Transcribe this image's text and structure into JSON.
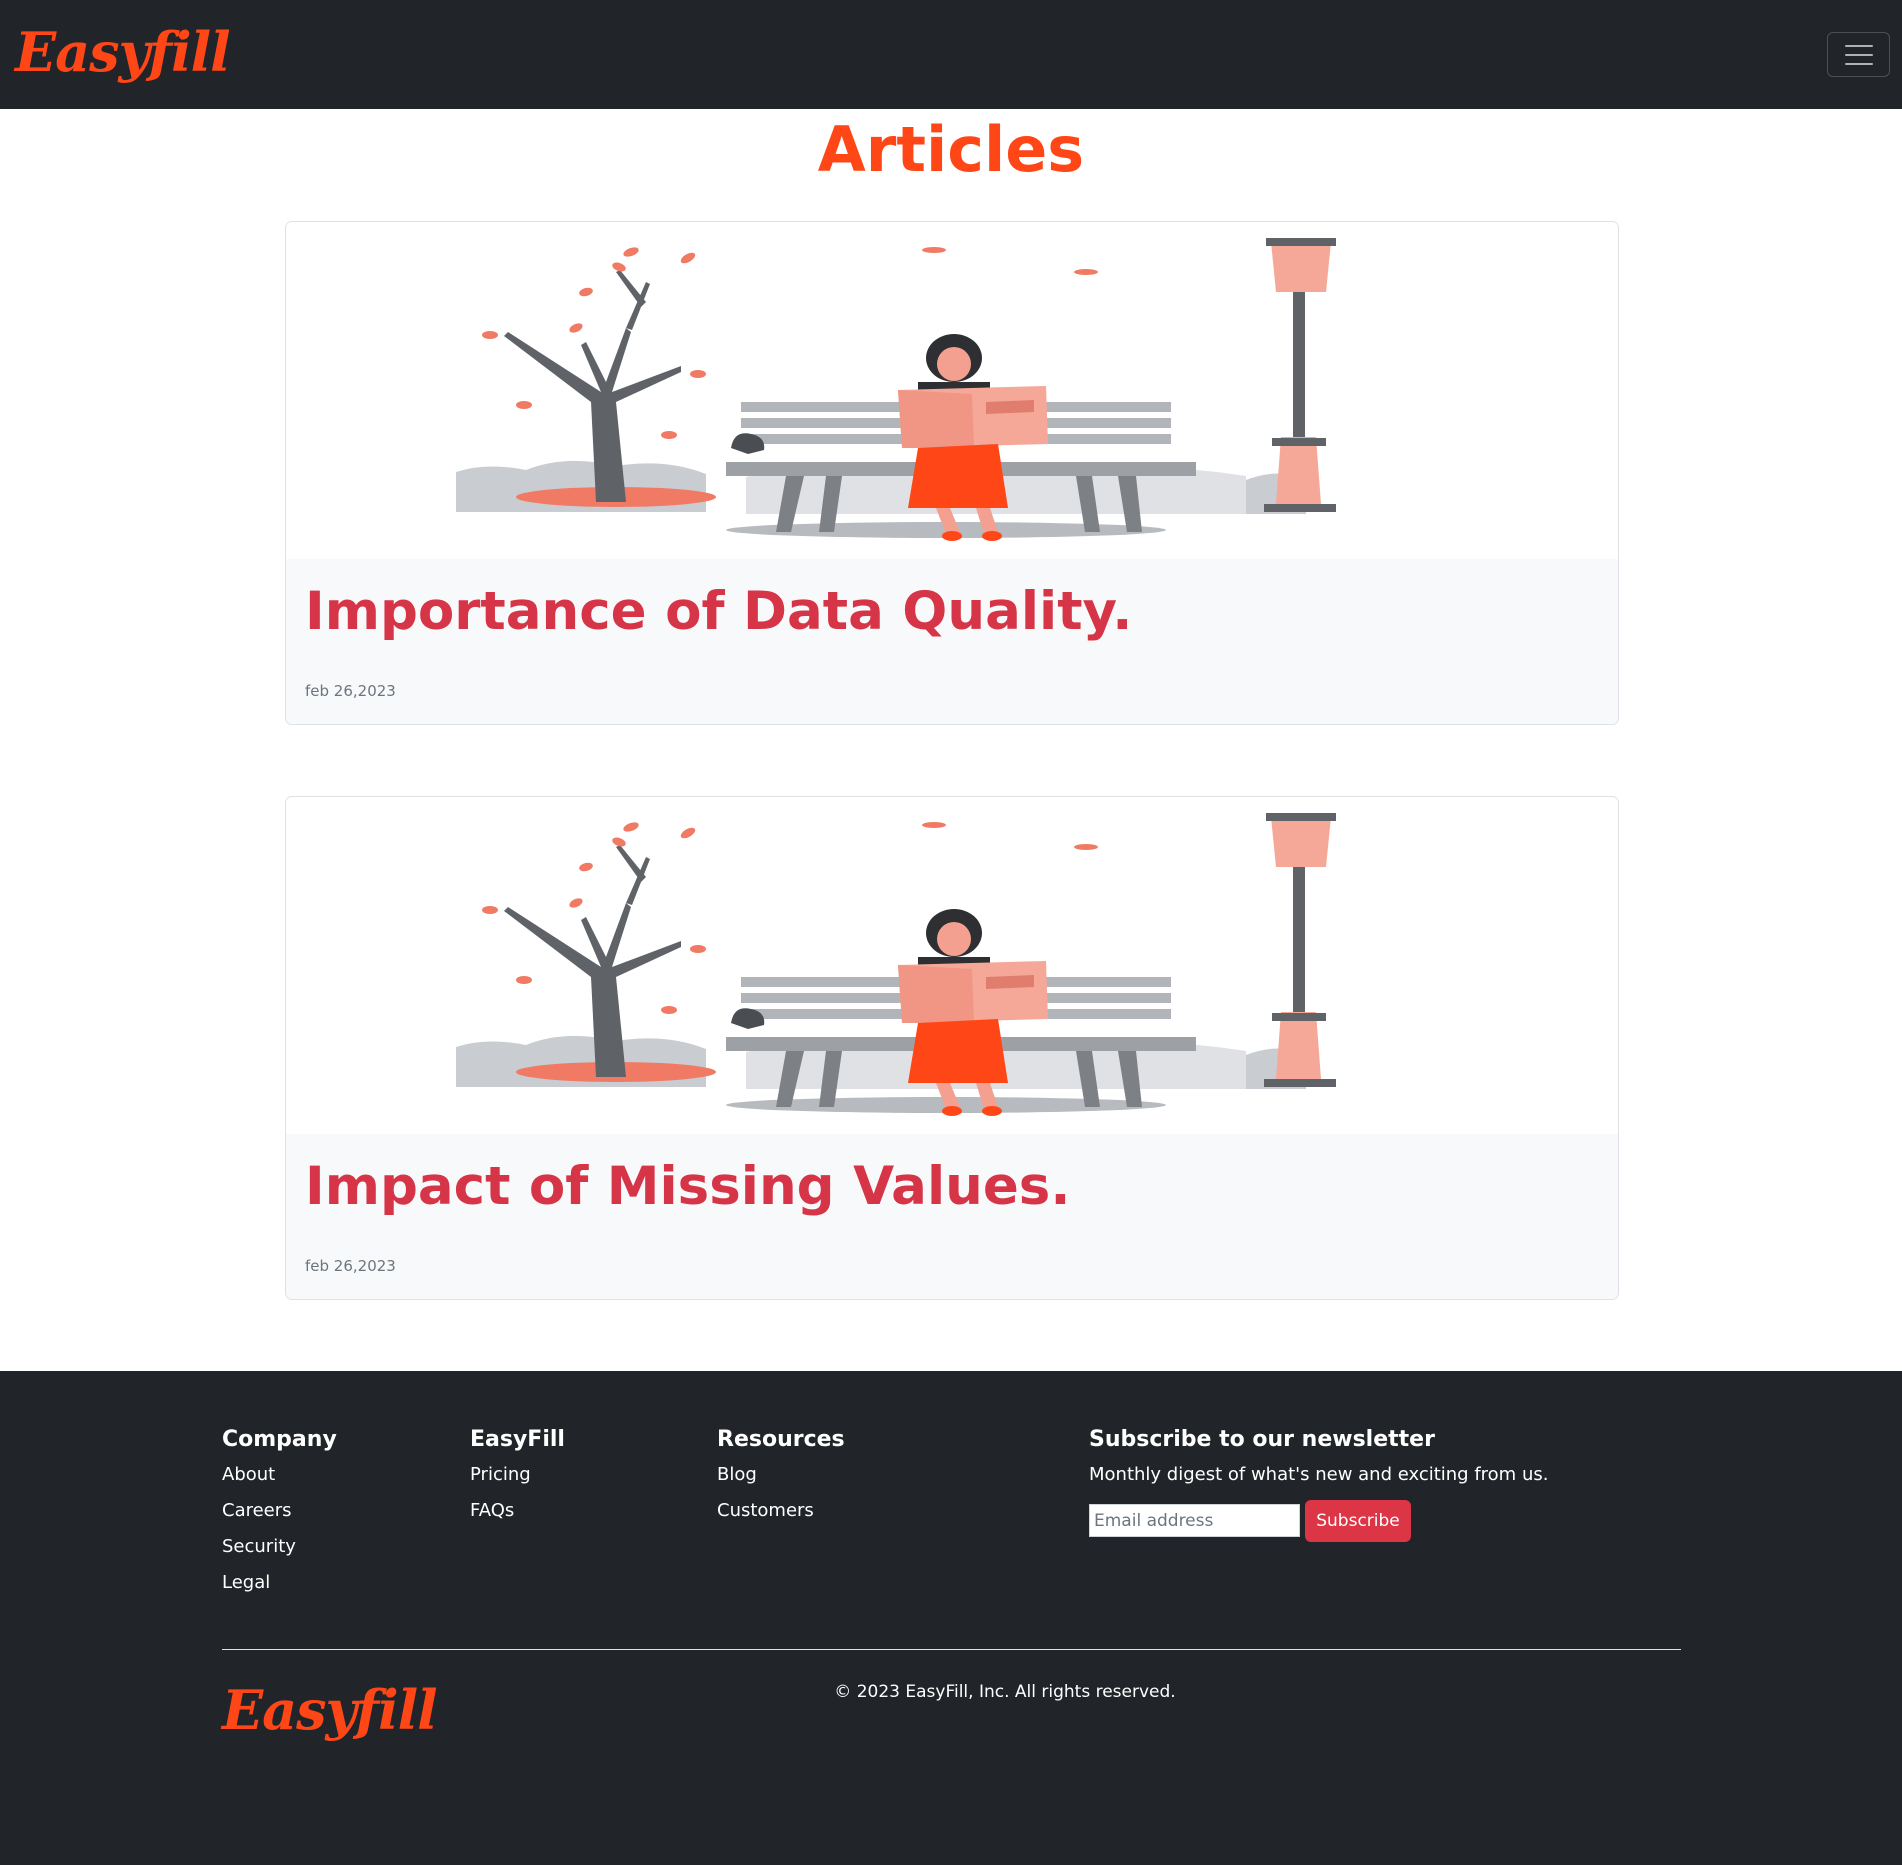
{
  "navbar": {
    "logo": "Easyfill",
    "toggle_icon": "hamburger-icon"
  },
  "page": {
    "title": "Articles"
  },
  "articles": [
    {
      "title": "Importance of Data Quality.",
      "date": "feb 26,2023"
    },
    {
      "title": "Impact of Missing Values.",
      "date": "feb 26,2023"
    }
  ],
  "footer": {
    "company": {
      "heading": "Company",
      "links": [
        "About",
        "Careers",
        "Security",
        "Legal"
      ]
    },
    "easyfill": {
      "heading": "EasyFill",
      "links": [
        "Pricing",
        "FAQs"
      ]
    },
    "resources": {
      "heading": "Resources",
      "links": [
        "Blog",
        "Customers"
      ]
    },
    "newsletter": {
      "heading": "Subscribe to our newsletter",
      "description": "Monthly digest of what's new and exciting from us.",
      "email_placeholder": "Email address",
      "button_label": "Subscribe"
    },
    "logo": "Easyfill",
    "copyright": "© 2023 EasyFill, Inc. All rights reserved."
  },
  "colors": {
    "brand_orange": "#ff4616",
    "card_title_red": "#d63447",
    "subscribe_red": "#dc3545",
    "dark_bg": "#212529"
  }
}
